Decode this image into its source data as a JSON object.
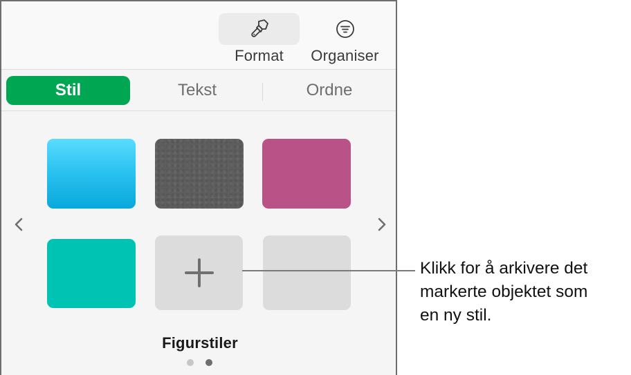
{
  "toolbar": {
    "buttons": [
      {
        "label": "Format",
        "icon": "paintbrush-icon",
        "active": true
      },
      {
        "label": "Organiser",
        "icon": "filter-circle-icon",
        "active": false
      }
    ]
  },
  "tabs": [
    {
      "label": "Stil",
      "active": true
    },
    {
      "label": "Tekst",
      "active": false
    },
    {
      "label": "Ordne",
      "active": false
    }
  ],
  "styles_grid": {
    "title": "Figurstiler",
    "tiles": [
      {
        "kind": "style",
        "fill": "blue-gradient",
        "color": "#2cc3f0"
      },
      {
        "kind": "style",
        "fill": "gray-texture",
        "color": "#5e5e5e"
      },
      {
        "kind": "style",
        "fill": "pink-texture",
        "color": "#b85287"
      },
      {
        "kind": "style",
        "fill": "teal-solid",
        "color": "#00c3b4"
      },
      {
        "kind": "add-style",
        "icon": "plus-icon"
      },
      {
        "kind": "empty"
      }
    ],
    "pagination": {
      "pages": 2,
      "current": 2
    },
    "prev_icon": "chevron-left-icon",
    "next_icon": "chevron-right-icon"
  },
  "colors": {
    "accent_green": "#00a651",
    "panel_bg": "#f5f5f5",
    "tile_placeholder": "#dcdcdc"
  },
  "callout": {
    "text": "Klikk for å arkivere det markerte objektet som en ny stil.",
    "lines": [
      "Klikk for å arkivere det",
      "markerte objektet som",
      "en ny stil."
    ]
  }
}
